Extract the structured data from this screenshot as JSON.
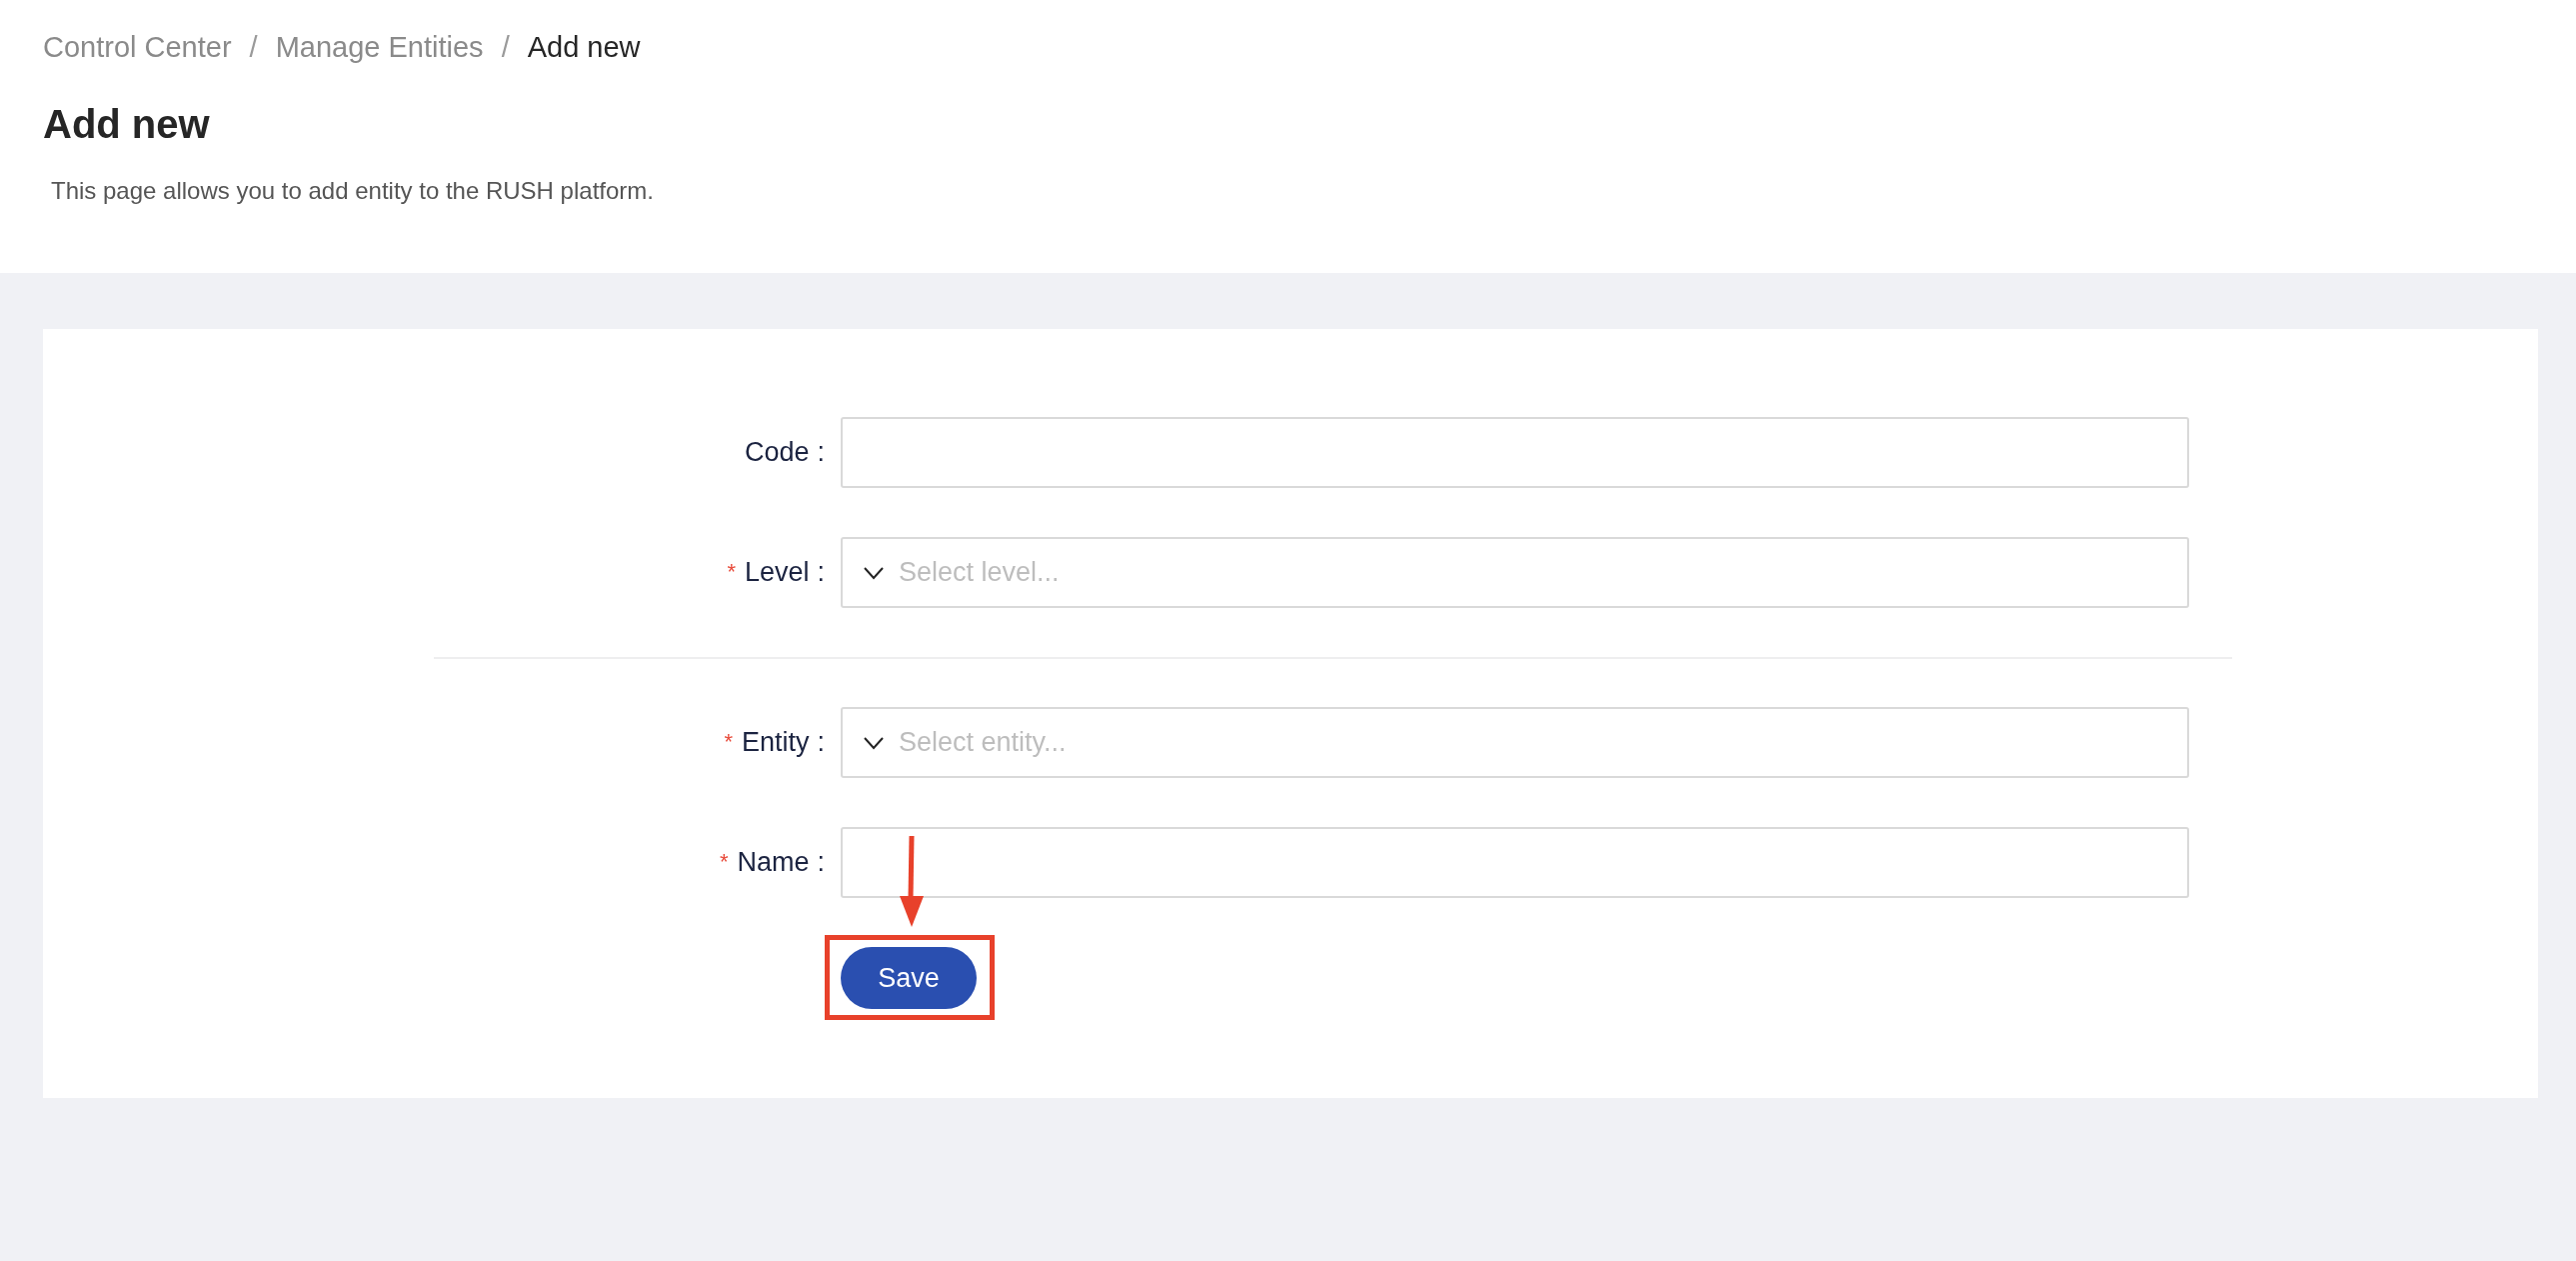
{
  "breadcrumb": [
    {
      "label": "Control Center",
      "current": false
    },
    {
      "label": "Manage Entities",
      "current": false
    },
    {
      "label": "Add new",
      "current": true
    }
  ],
  "breadcrumb_separator": "/",
  "title": "Add new",
  "description": "This page allows you to add entity to the RUSH platform.",
  "form": {
    "required_mark": "*",
    "label_suffix": ":",
    "groups": [
      [
        {
          "kind": "text",
          "label": "Code",
          "required": false
        },
        {
          "kind": "select",
          "label": "Level",
          "required": true,
          "placeholder": "Select level..."
        }
      ],
      [
        {
          "kind": "select",
          "label": "Entity",
          "required": true,
          "placeholder": "Select entity..."
        },
        {
          "kind": "text",
          "label": "Name",
          "required": true
        }
      ]
    ],
    "submit": {
      "label": "Save",
      "highlighted": true
    }
  }
}
